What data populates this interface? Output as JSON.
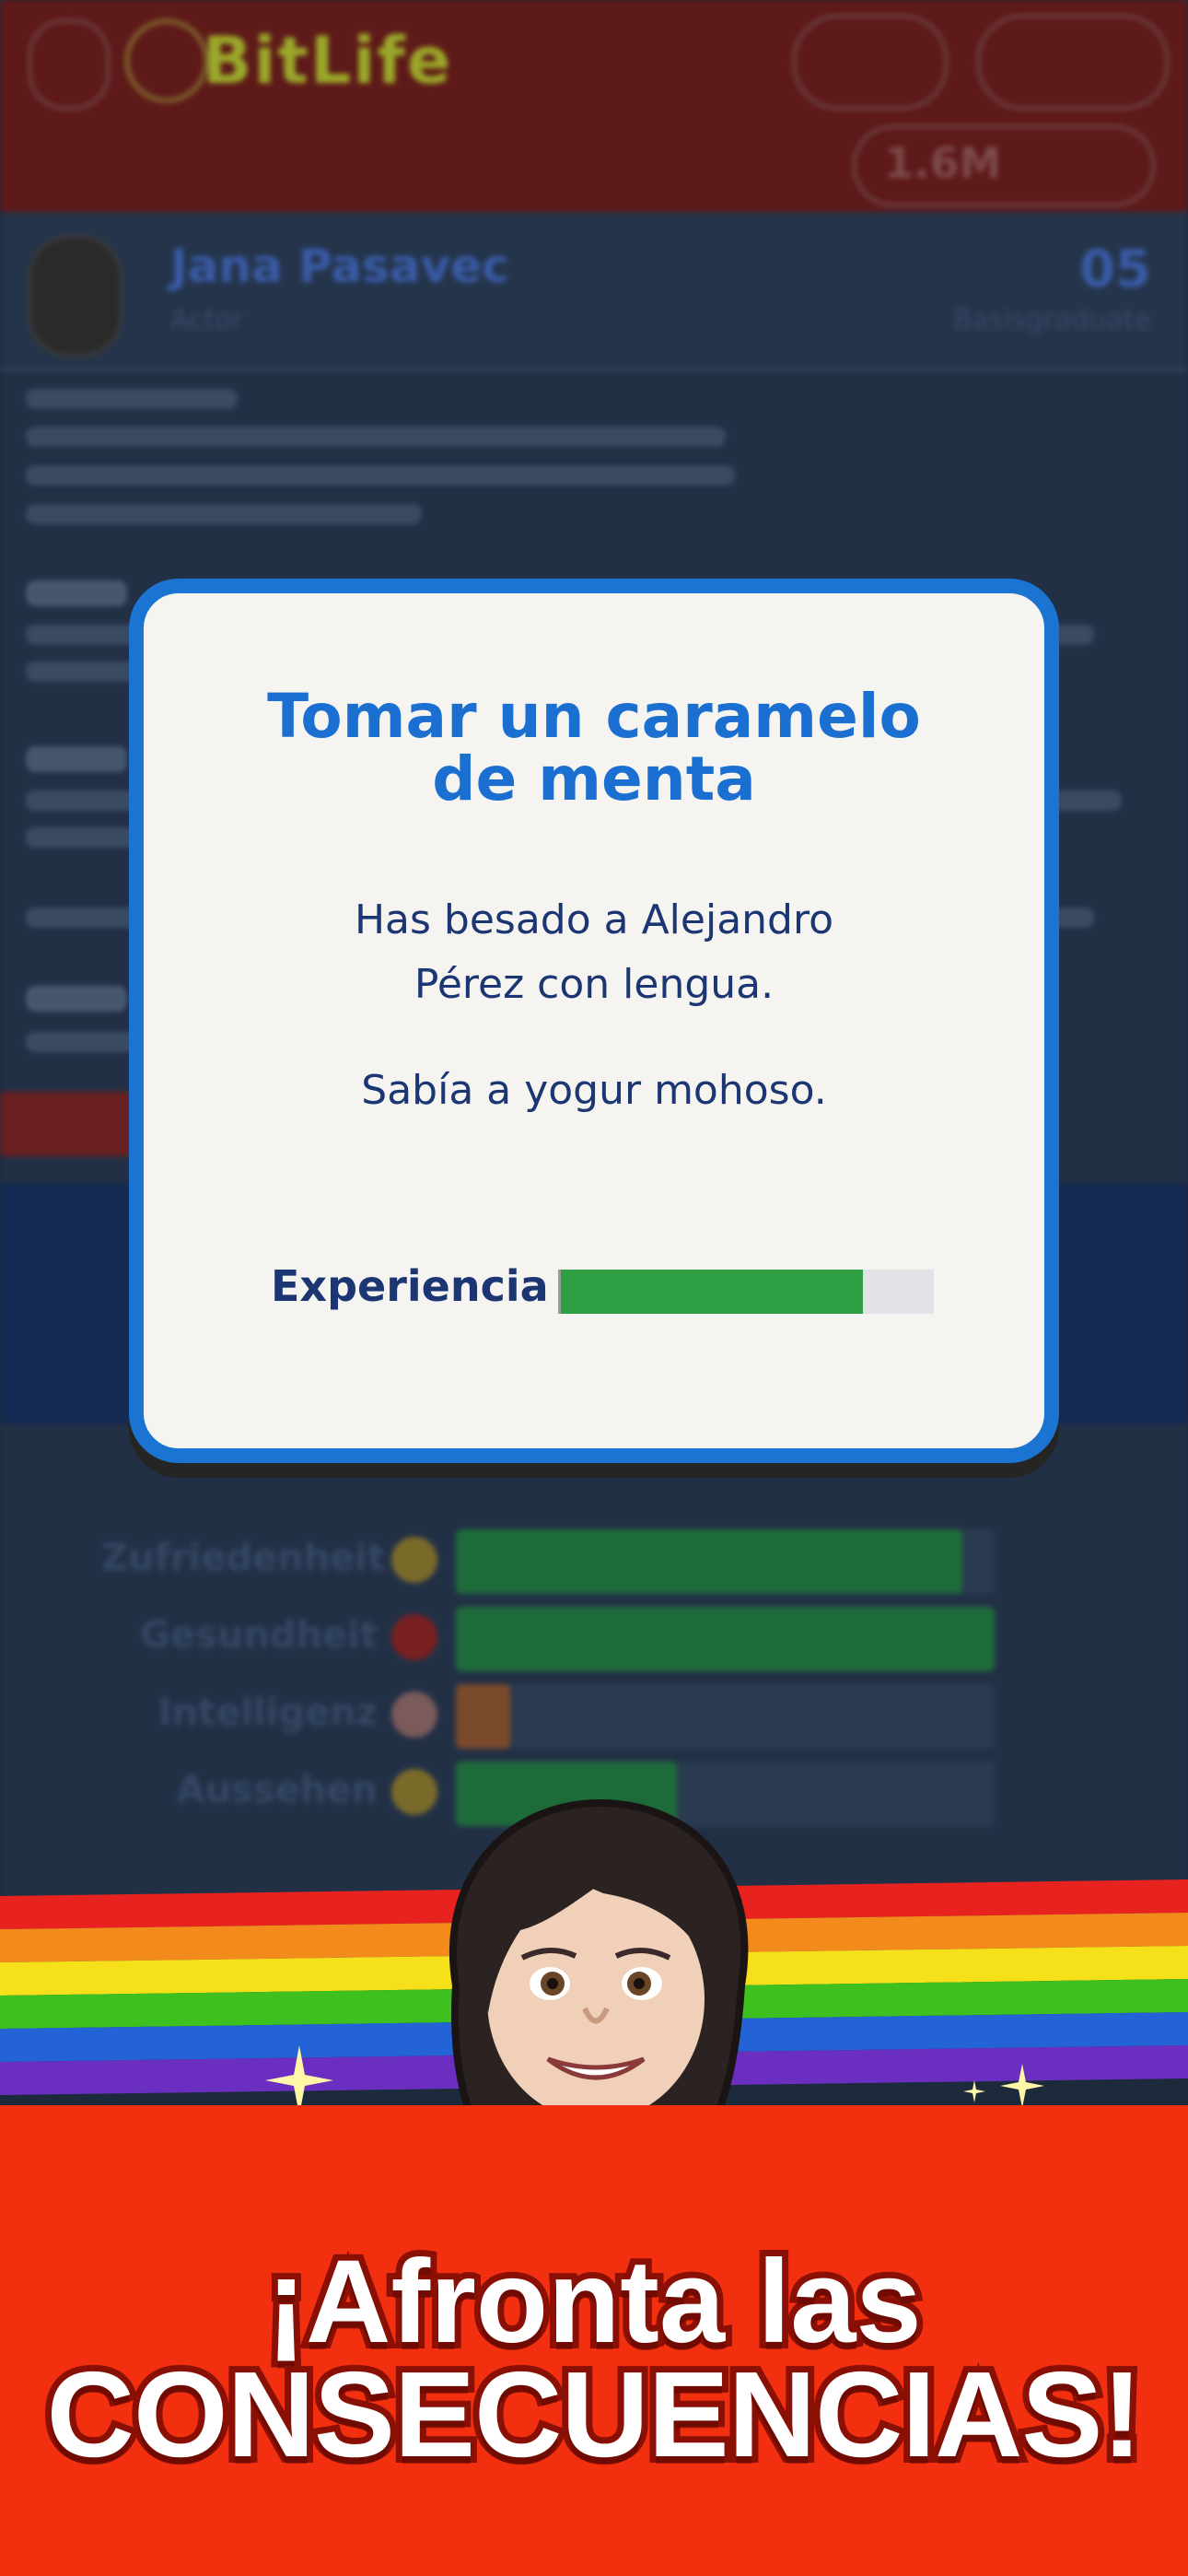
{
  "background": {
    "app_logo": "BitLife",
    "money_value": "1.6M",
    "profile": {
      "name": "Jana Pasavec",
      "job": "Actor",
      "age": "05",
      "status": "Basisgraduate"
    },
    "stats": [
      {
        "label": "Zufriedenheit",
        "percent": 0.94,
        "color": "#1e6b3a"
      },
      {
        "label": "Gesundheit",
        "percent": 1.0,
        "color": "#1e6b3a"
      },
      {
        "label": "Intelligenz",
        "percent": 0.1,
        "color": "#7a4a2a"
      },
      {
        "label": "Aussehen",
        "percent": 0.41,
        "color": "#1e6b3a"
      }
    ]
  },
  "dialog": {
    "title_line1": "Tomar un caramelo",
    "title_line2": "de menta",
    "message_line1": "Has besado a Alejandro",
    "message_line2": "Pérez con lengua.",
    "message2": "Sabía a yogur mohoso.",
    "bar_label": "Experiencia",
    "bar_percent": 0.81,
    "accent_color": "#1b74d1",
    "bar_color": "#2ea043"
  },
  "banner": {
    "line1": "¡Afronta las",
    "line2": "CONSECUENCIAS!"
  }
}
